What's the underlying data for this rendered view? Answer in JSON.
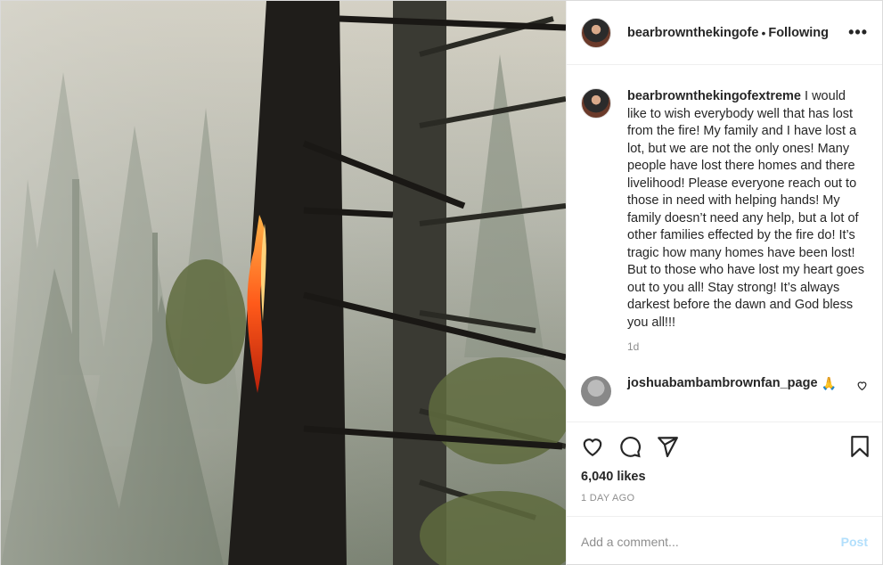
{
  "header": {
    "username": "bearbrownthekingofe",
    "separator": "•",
    "follow_status": "Following",
    "more": "•••"
  },
  "caption": {
    "username": "bearbrownthekingofextreme",
    "text": "I would like to wish everybody well that has lost from the fire! My family and I have lost a lot, but we are not the only ones! Many people have lost there homes and there livelihood! Please everyone reach out to those in need with helping hands! My family doesn’t need any help, but a lot of other families effected by the fire do! It’s tragic how many homes have been lost! But to those who have lost my heart goes out to you all! Stay strong! It’s always darkest before the dawn and God bless you all!!!",
    "age": "1d"
  },
  "comment": {
    "username": "joshuabambambrownfan_page",
    "text": "🙏"
  },
  "actions": {
    "icons": [
      "heart-icon",
      "comment-icon",
      "share-icon",
      "bookmark-icon"
    ]
  },
  "likes": "6,040 likes",
  "date": "1 DAY AGO",
  "add_comment": {
    "placeholder": "Add a comment...",
    "post_label": "Post"
  },
  "colors": {
    "text": "#262626",
    "muted": "#8e8e8e",
    "post_disabled": "#b2dffc",
    "fire": "#ff5a1a"
  }
}
